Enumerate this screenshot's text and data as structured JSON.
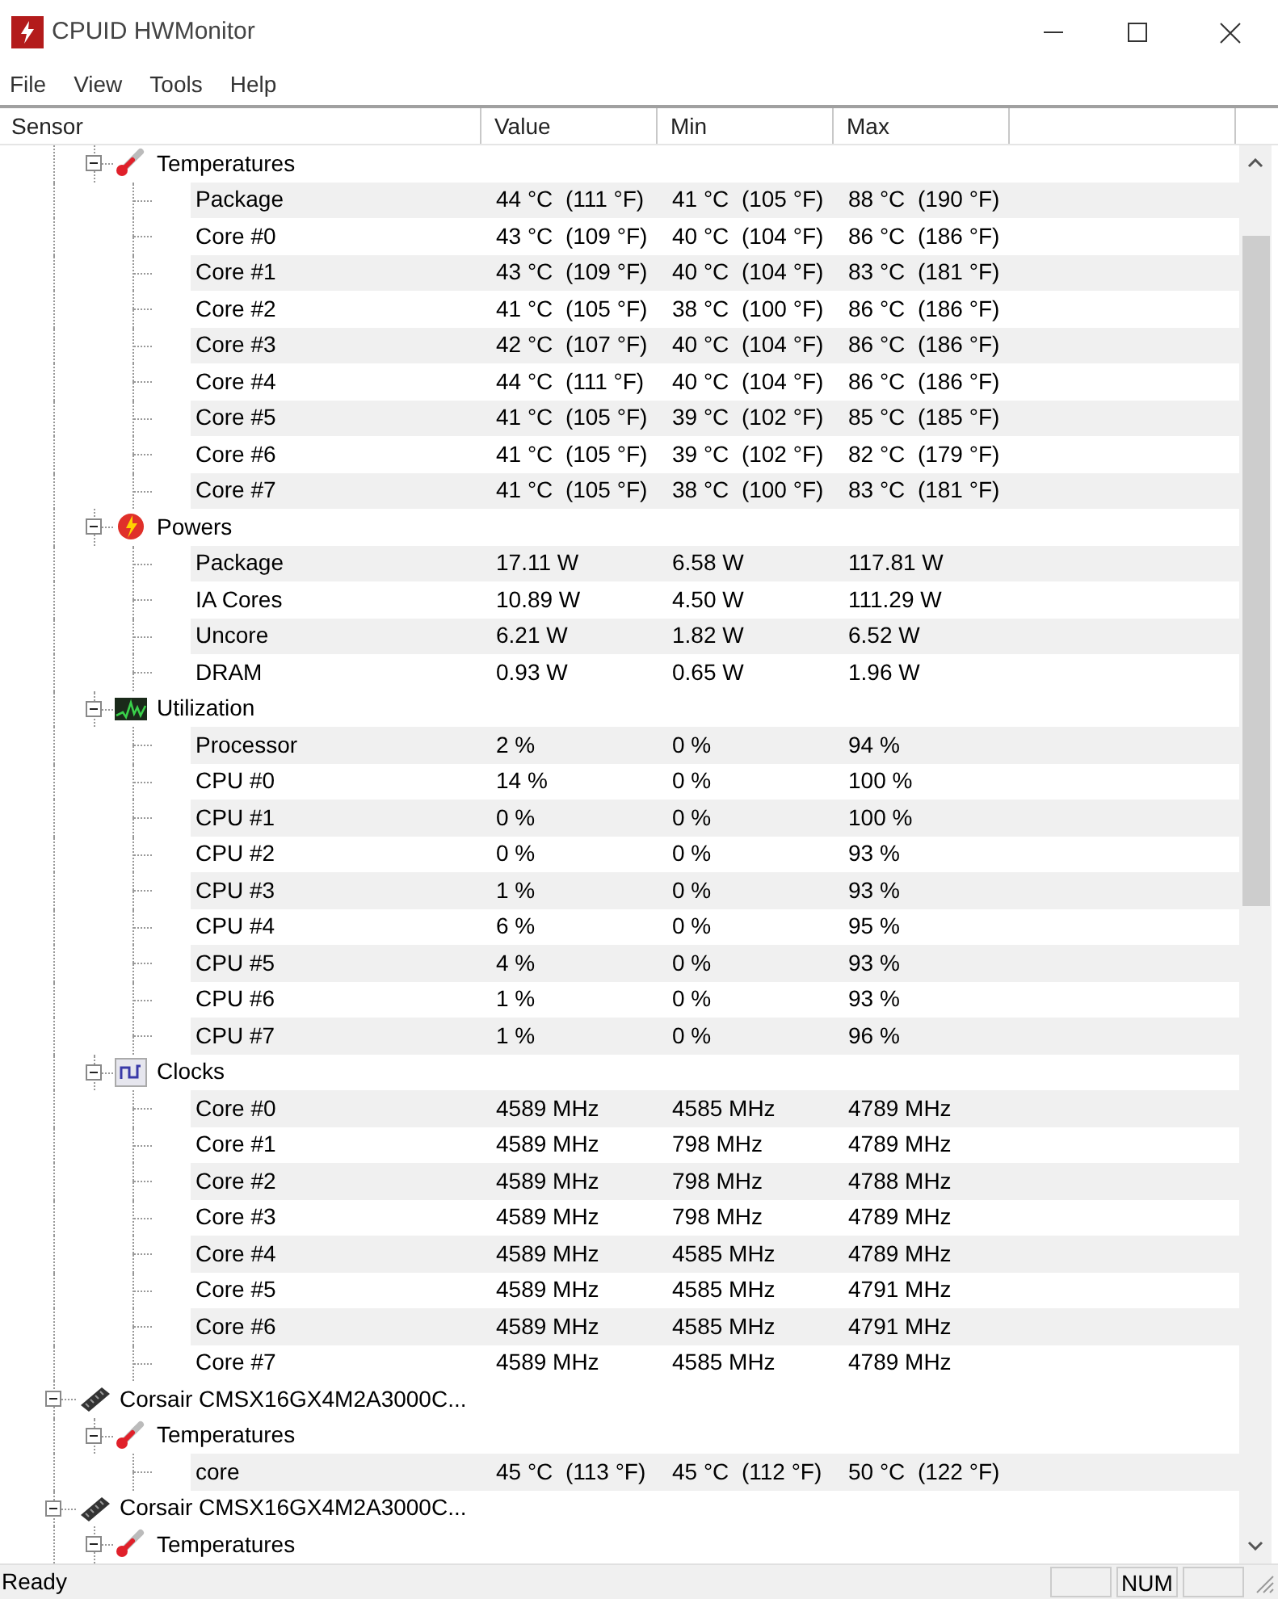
{
  "window": {
    "title": "CPUID HWMonitor"
  },
  "menu": [
    "File",
    "View",
    "Tools",
    "Help"
  ],
  "columns": [
    "Sensor",
    "Value",
    "Min",
    "Max"
  ],
  "tree": {
    "continued_groups": [
      {
        "label": "Temperatures",
        "kind": "temperature",
        "expanded": true,
        "children": [
          {
            "label": "Package",
            "value": "44 °C  (111 °F)",
            "min": "41 °C  (105 °F)",
            "max": "88 °C  (190 °F)"
          },
          {
            "label": "Core #0",
            "value": "43 °C  (109 °F)",
            "min": "40 °C  (104 °F)",
            "max": "86 °C  (186 °F)"
          },
          {
            "label": "Core #1",
            "value": "43 °C  (109 °F)",
            "min": "40 °C  (104 °F)",
            "max": "83 °C  (181 °F)"
          },
          {
            "label": "Core #2",
            "value": "41 °C  (105 °F)",
            "min": "38 °C  (100 °F)",
            "max": "86 °C  (186 °F)"
          },
          {
            "label": "Core #3",
            "value": "42 °C  (107 °F)",
            "min": "40 °C  (104 °F)",
            "max": "86 °C  (186 °F)"
          },
          {
            "label": "Core #4",
            "value": "44 °C  (111 °F)",
            "min": "40 °C  (104 °F)",
            "max": "86 °C  (186 °F)"
          },
          {
            "label": "Core #5",
            "value": "41 °C  (105 °F)",
            "min": "39 °C  (102 °F)",
            "max": "85 °C  (185 °F)"
          },
          {
            "label": "Core #6",
            "value": "41 °C  (105 °F)",
            "min": "39 °C  (102 °F)",
            "max": "82 °C  (179 °F)"
          },
          {
            "label": "Core #7",
            "value": "41 °C  (105 °F)",
            "min": "38 °C  (100 °F)",
            "max": "83 °C  (181 °F)"
          }
        ]
      },
      {
        "label": "Powers",
        "kind": "power",
        "expanded": true,
        "children": [
          {
            "label": "Package",
            "value": "17.11 W",
            "min": "6.58 W",
            "max": "117.81 W"
          },
          {
            "label": "IA Cores",
            "value": "10.89 W",
            "min": "4.50 W",
            "max": "111.29 W"
          },
          {
            "label": "Uncore",
            "value": "6.21 W",
            "min": "1.82 W",
            "max": "6.52 W"
          },
          {
            "label": "DRAM",
            "value": "0.93 W",
            "min": "0.65 W",
            "max": "1.96 W"
          }
        ]
      },
      {
        "label": "Utilization",
        "kind": "utilization",
        "expanded": true,
        "children": [
          {
            "label": "Processor",
            "value": "2 %",
            "min": "0 %",
            "max": "94 %"
          },
          {
            "label": "CPU #0",
            "value": "14 %",
            "min": "0 %",
            "max": "100 %"
          },
          {
            "label": "CPU #1",
            "value": "0 %",
            "min": "0 %",
            "max": "100 %"
          },
          {
            "label": "CPU #2",
            "value": "0 %",
            "min": "0 %",
            "max": "93 %"
          },
          {
            "label": "CPU #3",
            "value": "1 %",
            "min": "0 %",
            "max": "93 %"
          },
          {
            "label": "CPU #4",
            "value": "6 %",
            "min": "0 %",
            "max": "95 %"
          },
          {
            "label": "CPU #5",
            "value": "4 %",
            "min": "0 %",
            "max": "93 %"
          },
          {
            "label": "CPU #6",
            "value": "1 %",
            "min": "0 %",
            "max": "93 %"
          },
          {
            "label": "CPU #7",
            "value": "1 %",
            "min": "0 %",
            "max": "96 %"
          }
        ]
      },
      {
        "label": "Clocks",
        "kind": "clock",
        "expanded": true,
        "children": [
          {
            "label": "Core #0",
            "value": "4589 MHz",
            "min": "4585 MHz",
            "max": "4789 MHz"
          },
          {
            "label": "Core #1",
            "value": "4589 MHz",
            "min": "798 MHz",
            "max": "4789 MHz"
          },
          {
            "label": "Core #2",
            "value": "4589 MHz",
            "min": "798 MHz",
            "max": "4788 MHz"
          },
          {
            "label": "Core #3",
            "value": "4589 MHz",
            "min": "798 MHz",
            "max": "4789 MHz"
          },
          {
            "label": "Core #4",
            "value": "4589 MHz",
            "min": "4585 MHz",
            "max": "4789 MHz"
          },
          {
            "label": "Core #5",
            "value": "4589 MHz",
            "min": "4585 MHz",
            "max": "4791 MHz"
          },
          {
            "label": "Core #6",
            "value": "4589 MHz",
            "min": "4585 MHz",
            "max": "4791 MHz"
          },
          {
            "label": "Core #7",
            "value": "4589 MHz",
            "min": "4585 MHz",
            "max": "4789 MHz"
          }
        ]
      }
    ],
    "devices": [
      {
        "label": "Corsair CMSX16GX4M2A3000C...",
        "expanded": true,
        "children": [
          {
            "label": "Temperatures",
            "kind": "temperature",
            "expanded": true,
            "children": [
              {
                "label": "core",
                "value": "45 °C  (113 °F)",
                "min": "45 °C  (112 °F)",
                "max": "50 °C  (122 °F)"
              }
            ]
          }
        ]
      },
      {
        "label": "Corsair CMSX16GX4M2A3000C...",
        "expanded": true,
        "children": [
          {
            "label": "Temperatures",
            "kind": "temperature",
            "expanded": true
          }
        ]
      }
    ]
  },
  "status_bar": {
    "text": "Ready",
    "indicator": "NUM"
  }
}
